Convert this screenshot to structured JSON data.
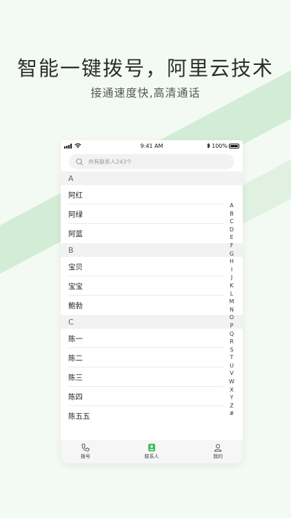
{
  "promo": {
    "headline": "智能一键拨号，阿里云技术",
    "subline": "接通速度快,高清通话"
  },
  "status_bar": {
    "time": "9:41 AM",
    "battery": "100%"
  },
  "search": {
    "placeholder": "共有联系人243个"
  },
  "contacts": {
    "sections": [
      {
        "letter": "A",
        "names": [
          "阿红",
          "阿绿",
          "阿蓝"
        ]
      },
      {
        "letter": "B",
        "names": [
          "宝贝",
          "宝宝",
          "鲍勃"
        ]
      },
      {
        "letter": "C",
        "names": [
          "陈一",
          "陈二",
          "陈三",
          "陈四",
          "陈五五"
        ]
      }
    ]
  },
  "index_letters": [
    "A",
    "B",
    "C",
    "D",
    "E",
    "F",
    "G",
    "H",
    "I",
    "J",
    "K",
    "L",
    "M",
    "N",
    "O",
    "P",
    "Q",
    "R",
    "S",
    "T",
    "U",
    "V",
    "W",
    "X",
    "Y",
    "Z",
    "#"
  ],
  "tabs": [
    {
      "label": "拨号",
      "icon": "phone-icon"
    },
    {
      "label": "联系人",
      "icon": "contacts-icon"
    },
    {
      "label": "我的",
      "icon": "person-icon"
    }
  ],
  "colors": {
    "accent": "#3ebd5a",
    "background": "#f3faf4"
  }
}
